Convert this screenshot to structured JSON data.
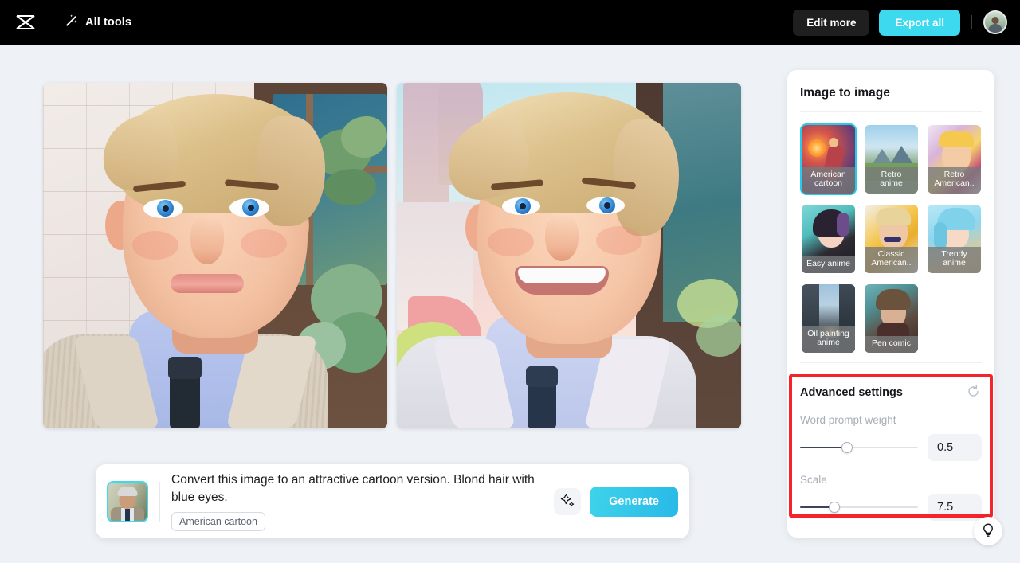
{
  "header": {
    "logo_icon": "capcut-logo-icon",
    "all_tools_icon": "magic-wand-icon",
    "all_tools_label": "All tools",
    "edit_more_label": "Edit more",
    "export_all_label": "Export all",
    "avatar_name": "user-avatar",
    "bg_color": "#000000",
    "accent_color": "#3dd9ee"
  },
  "canvas": {
    "images": [
      {
        "name": "generated-image-1",
        "alt": "Cartoon portrait of blond man in beige suit against brick wall and window with plants"
      },
      {
        "name": "generated-image-2",
        "alt": "Cartoon portrait of smiling blond man in light suit against pastel city background"
      }
    ]
  },
  "prompt": {
    "thumbnail_name": "source-image-thumbnail",
    "text": "Convert this image to an attractive cartoon version. Blond hair with blue eyes.",
    "style_tag": "American cartoon",
    "magic_icon": "sparkle-icon",
    "generate_label": "Generate",
    "generate_color": "#28b9e8"
  },
  "panel": {
    "title": "Image to image",
    "styles": [
      {
        "label": "American\ncartoon",
        "selected": true
      },
      {
        "label": "Retro\nanime",
        "selected": false
      },
      {
        "label": "Retro\nAmerican..",
        "selected": false
      },
      {
        "label": "Easy anime",
        "selected": false
      },
      {
        "label": "Classic\nAmerican..",
        "selected": false
      },
      {
        "label": "Trendy\nanime",
        "selected": false
      },
      {
        "label": "Oil painting\nanime",
        "selected": false
      },
      {
        "label": "Pen comic",
        "selected": false
      }
    ],
    "advanced": {
      "title": "Advanced settings",
      "reset_icon": "reset-icon",
      "fields": [
        {
          "label": "Word prompt weight",
          "value": "0.5",
          "percent": 40
        },
        {
          "label": "Scale",
          "value": "7.5",
          "percent": 29
        }
      ]
    },
    "selected_border_color": "#23ccef"
  },
  "annotation": {
    "name": "highlight-box-advanced-settings",
    "color": "#f5232b"
  },
  "hint": {
    "icon": "lightbulb-icon"
  }
}
